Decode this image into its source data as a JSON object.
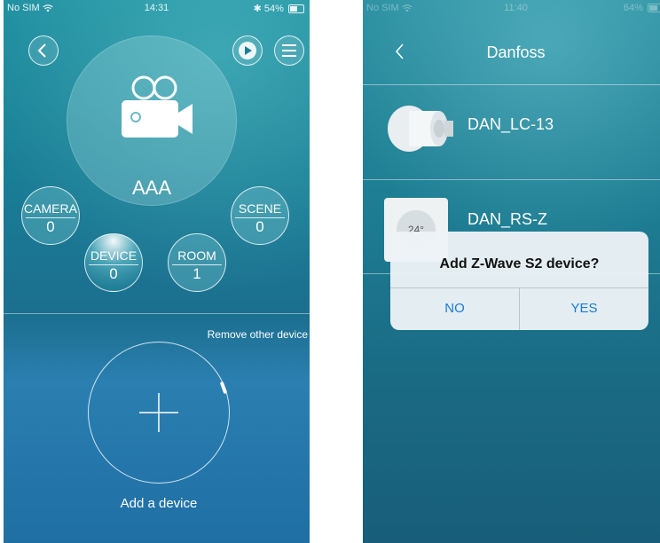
{
  "left_phone": {
    "status": {
      "carrier": "No SIM",
      "time": "14:31",
      "battery": "54%",
      "battery_level": 0.54
    },
    "icons": {
      "back": "back-chevron-icon",
      "play": "play-icon",
      "menu": "hamburger-menu-icon",
      "camera": "video-camera-icon",
      "plus": "plus-icon"
    },
    "hub_name": "AAA",
    "stats": {
      "camera": {
        "label": "CAMERA",
        "value": "0"
      },
      "scene": {
        "label": "SCENE",
        "value": "0"
      },
      "device": {
        "label": "DEVICE",
        "value": "0"
      },
      "room": {
        "label": "ROOM",
        "value": "1"
      }
    },
    "remove_link": "Remove other device",
    "add_label": "Add a device"
  },
  "right_phone": {
    "status": {
      "carrier": "No SIM",
      "time": "11:40",
      "battery": "64%",
      "battery_level": 0.64
    },
    "title": "Danfoss",
    "devices": [
      {
        "name": "DAN_LC-13",
        "icon": "radiator-thermostat-icon"
      },
      {
        "name": "DAN_RS-Z",
        "icon": "room-sensor-icon"
      }
    ],
    "dialog": {
      "title": "Add Z-Wave S2 device?",
      "no": "NO",
      "yes": "YES"
    }
  }
}
